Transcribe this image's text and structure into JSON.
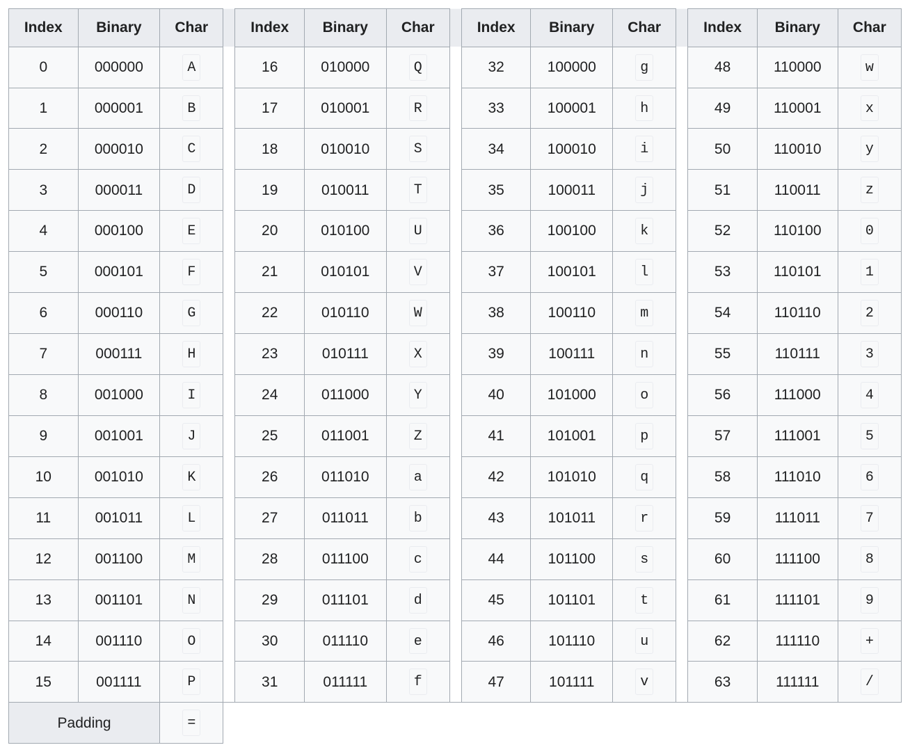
{
  "headers": {
    "index": "Index",
    "binary": "Binary",
    "char": "Char"
  },
  "padding": {
    "label": "Padding",
    "char": "="
  },
  "columns": [
    [
      {
        "index": "0",
        "binary": "000000",
        "char": "A"
      },
      {
        "index": "1",
        "binary": "000001",
        "char": "B"
      },
      {
        "index": "2",
        "binary": "000010",
        "char": "C"
      },
      {
        "index": "3",
        "binary": "000011",
        "char": "D"
      },
      {
        "index": "4",
        "binary": "000100",
        "char": "E"
      },
      {
        "index": "5",
        "binary": "000101",
        "char": "F"
      },
      {
        "index": "6",
        "binary": "000110",
        "char": "G"
      },
      {
        "index": "7",
        "binary": "000111",
        "char": "H"
      },
      {
        "index": "8",
        "binary": "001000",
        "char": "I"
      },
      {
        "index": "9",
        "binary": "001001",
        "char": "J"
      },
      {
        "index": "10",
        "binary": "001010",
        "char": "K"
      },
      {
        "index": "11",
        "binary": "001011",
        "char": "L"
      },
      {
        "index": "12",
        "binary": "001100",
        "char": "M"
      },
      {
        "index": "13",
        "binary": "001101",
        "char": "N"
      },
      {
        "index": "14",
        "binary": "001110",
        "char": "O"
      },
      {
        "index": "15",
        "binary": "001111",
        "char": "P"
      }
    ],
    [
      {
        "index": "16",
        "binary": "010000",
        "char": "Q"
      },
      {
        "index": "17",
        "binary": "010001",
        "char": "R"
      },
      {
        "index": "18",
        "binary": "010010",
        "char": "S"
      },
      {
        "index": "19",
        "binary": "010011",
        "char": "T"
      },
      {
        "index": "20",
        "binary": "010100",
        "char": "U"
      },
      {
        "index": "21",
        "binary": "010101",
        "char": "V"
      },
      {
        "index": "22",
        "binary": "010110",
        "char": "W"
      },
      {
        "index": "23",
        "binary": "010111",
        "char": "X"
      },
      {
        "index": "24",
        "binary": "011000",
        "char": "Y"
      },
      {
        "index": "25",
        "binary": "011001",
        "char": "Z"
      },
      {
        "index": "26",
        "binary": "011010",
        "char": "a"
      },
      {
        "index": "27",
        "binary": "011011",
        "char": "b"
      },
      {
        "index": "28",
        "binary": "011100",
        "char": "c"
      },
      {
        "index": "29",
        "binary": "011101",
        "char": "d"
      },
      {
        "index": "30",
        "binary": "011110",
        "char": "e"
      },
      {
        "index": "31",
        "binary": "011111",
        "char": "f"
      }
    ],
    [
      {
        "index": "32",
        "binary": "100000",
        "char": "g"
      },
      {
        "index": "33",
        "binary": "100001",
        "char": "h"
      },
      {
        "index": "34",
        "binary": "100010",
        "char": "i"
      },
      {
        "index": "35",
        "binary": "100011",
        "char": "j"
      },
      {
        "index": "36",
        "binary": "100100",
        "char": "k"
      },
      {
        "index": "37",
        "binary": "100101",
        "char": "l"
      },
      {
        "index": "38",
        "binary": "100110",
        "char": "m"
      },
      {
        "index": "39",
        "binary": "100111",
        "char": "n"
      },
      {
        "index": "40",
        "binary": "101000",
        "char": "o"
      },
      {
        "index": "41",
        "binary": "101001",
        "char": "p"
      },
      {
        "index": "42",
        "binary": "101010",
        "char": "q"
      },
      {
        "index": "43",
        "binary": "101011",
        "char": "r"
      },
      {
        "index": "44",
        "binary": "101100",
        "char": "s"
      },
      {
        "index": "45",
        "binary": "101101",
        "char": "t"
      },
      {
        "index": "46",
        "binary": "101110",
        "char": "u"
      },
      {
        "index": "47",
        "binary": "101111",
        "char": "v"
      }
    ],
    [
      {
        "index": "48",
        "binary": "110000",
        "char": "w"
      },
      {
        "index": "49",
        "binary": "110001",
        "char": "x"
      },
      {
        "index": "50",
        "binary": "110010",
        "char": "y"
      },
      {
        "index": "51",
        "binary": "110011",
        "char": "z"
      },
      {
        "index": "52",
        "binary": "110100",
        "char": "0"
      },
      {
        "index": "53",
        "binary": "110101",
        "char": "1"
      },
      {
        "index": "54",
        "binary": "110110",
        "char": "2"
      },
      {
        "index": "55",
        "binary": "110111",
        "char": "3"
      },
      {
        "index": "56",
        "binary": "111000",
        "char": "4"
      },
      {
        "index": "57",
        "binary": "111001",
        "char": "5"
      },
      {
        "index": "58",
        "binary": "111010",
        "char": "6"
      },
      {
        "index": "59",
        "binary": "111011",
        "char": "7"
      },
      {
        "index": "60",
        "binary": "111100",
        "char": "8"
      },
      {
        "index": "61",
        "binary": "111101",
        "char": "9"
      },
      {
        "index": "62",
        "binary": "111110",
        "char": "+"
      },
      {
        "index": "63",
        "binary": "111111",
        "char": "/"
      }
    ]
  ]
}
